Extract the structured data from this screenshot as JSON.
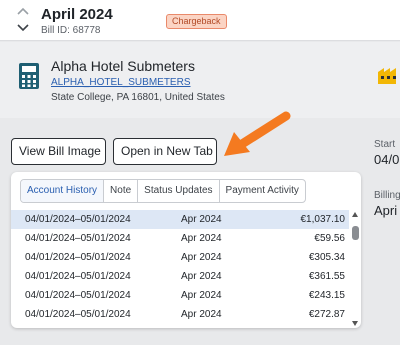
{
  "header": {
    "title": "April 2024",
    "bill_id": "Bill ID: 68778",
    "badge": "Chargeback",
    "badge_color": "#fbd4c4"
  },
  "vendor": {
    "icon": "calculator-icon",
    "name": "Alpha Hotel Submeters",
    "link": "ALPHA_HOTEL_SUBMETERS",
    "address": "State College, PA 16801, United States"
  },
  "actions": {
    "view_bill_image": "View Bill Image",
    "open_new_tab": "Open in New Tab",
    "arrow_color": "#f47a20"
  },
  "side": {
    "start_label": "Start",
    "start_value": "04/0",
    "billing_label": "Billing",
    "billing_value": "Apri"
  },
  "tabs": [
    "Account History",
    "Note",
    "Status Updates",
    "Payment Activity"
  ],
  "history": [
    {
      "range": "04/01/2024–05/01/2024",
      "month": "Apr 2024",
      "amount": "€1,037.10"
    },
    {
      "range": "04/01/2024–05/01/2024",
      "month": "Apr 2024",
      "amount": "€59.56"
    },
    {
      "range": "04/01/2024–05/01/2024",
      "month": "Apr 2024",
      "amount": "€305.34"
    },
    {
      "range": "04/01/2024–05/01/2024",
      "month": "Apr 2024",
      "amount": "€361.55"
    },
    {
      "range": "04/01/2024–05/01/2024",
      "month": "Apr 2024",
      "amount": "€243.15"
    },
    {
      "range": "04/01/2024–05/01/2024",
      "month": "Apr 2024",
      "amount": "€272.87"
    }
  ]
}
